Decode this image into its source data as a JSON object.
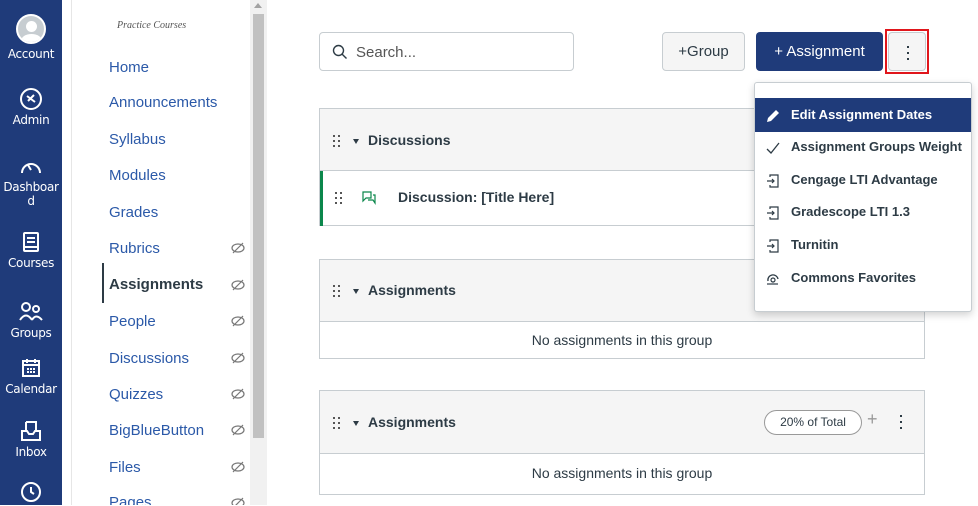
{
  "global_nav": {
    "items": [
      {
        "label": "Account",
        "icon": "account-avatar-icon"
      },
      {
        "label": "Admin",
        "icon": "shield-icon"
      },
      {
        "label": "Dashboar\nd",
        "icon": "dashboard-gauge-icon"
      },
      {
        "label": "Courses",
        "icon": "book-icon"
      },
      {
        "label": "Groups",
        "icon": "groups-icon"
      },
      {
        "label": "Calendar",
        "icon": "calendar-icon"
      },
      {
        "label": "Inbox",
        "icon": "inbox-icon"
      },
      {
        "label": "",
        "icon": "clock-icon"
      }
    ]
  },
  "course_nav": {
    "crumb": "Practice Courses",
    "items": [
      {
        "label": "Home",
        "hidden": false
      },
      {
        "label": "Announcements",
        "hidden": false
      },
      {
        "label": "Syllabus",
        "hidden": false
      },
      {
        "label": "Modules",
        "hidden": false
      },
      {
        "label": "Grades",
        "hidden": false
      },
      {
        "label": "Rubrics",
        "hidden": true
      },
      {
        "label": "Assignments",
        "hidden": true,
        "active": true
      },
      {
        "label": "People",
        "hidden": true
      },
      {
        "label": "Discussions",
        "hidden": true
      },
      {
        "label": "Quizzes",
        "hidden": true
      },
      {
        "label": "BigBlueButton",
        "hidden": true
      },
      {
        "label": "Files",
        "hidden": true
      },
      {
        "label": "Pages",
        "hidden": true
      }
    ]
  },
  "toolbar": {
    "search_placeholder": "Search...",
    "group_button": "+Group",
    "assignment_button": "+ Assignment"
  },
  "groups": [
    {
      "title": "Discussions",
      "items": [
        {
          "title": "Discussion: [Title Here]",
          "icon": "discussion-icon"
        }
      ]
    },
    {
      "title": "Assignments",
      "empty_text": "No assignments in this group"
    },
    {
      "title": "Assignments",
      "empty_text": "No assignments in this group",
      "weight": "20% of Total"
    }
  ],
  "menu": {
    "items": [
      {
        "label": "Edit Assignment Dates",
        "icon": "pencil-icon",
        "selected": true
      },
      {
        "label": "Assignment Groups Weight",
        "icon": "checkmark-icon"
      },
      {
        "label": "Cengage LTI Advantage",
        "icon": "lti-tool-icon"
      },
      {
        "label": "Gradescope LTI 1.3",
        "icon": "lti-tool-icon"
      },
      {
        "label": "Turnitin",
        "icon": "lti-tool-icon"
      },
      {
        "label": "Commons Favorites",
        "icon": "commons-icon"
      }
    ]
  },
  "colors": {
    "brand_nav": "#1f3b7a",
    "link": "#2b59a8",
    "highlight_box": "#e0161c",
    "published_green": "#0b874b"
  }
}
